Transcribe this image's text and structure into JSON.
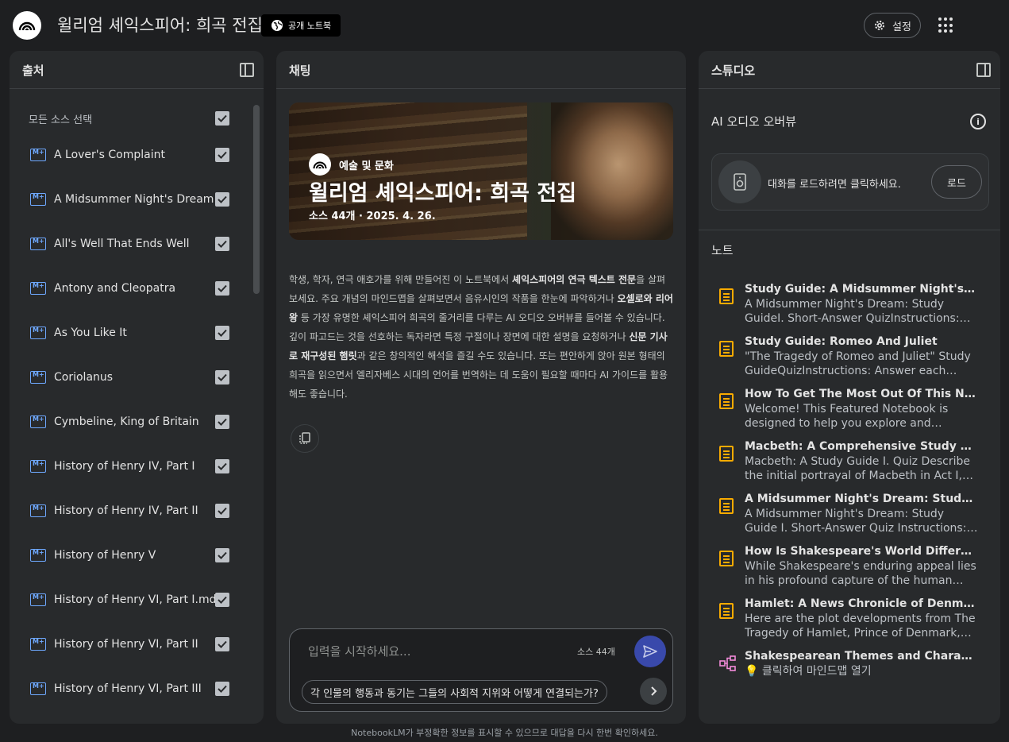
{
  "header": {
    "title": "윌리엄 셰익스피어: 희곡 전집",
    "public_badge": "공개 노트북",
    "settings_label": "설정"
  },
  "sources": {
    "panel_title": "출처",
    "select_all": "모든 소스 선택",
    "items": [
      {
        "label": "A Lover's Complaint"
      },
      {
        "label": "A Midsummer Night's Dream"
      },
      {
        "label": "All's Well That Ends Well"
      },
      {
        "label": "Antony and Cleopatra"
      },
      {
        "label": "As You Like It"
      },
      {
        "label": "Coriolanus"
      },
      {
        "label": "Cymbeline, King of Britain"
      },
      {
        "label": "History of Henry IV, Part I"
      },
      {
        "label": "History of Henry IV, Part II"
      },
      {
        "label": "History of Henry V"
      },
      {
        "label": "History of Henry VI, Part I.md"
      },
      {
        "label": "History of Henry VI, Part II"
      },
      {
        "label": "History of Henry VI, Part III"
      }
    ]
  },
  "chat": {
    "panel_title": "채팅",
    "hero": {
      "category": "예술 및 문화",
      "title": "윌리엄 셰익스피어: 희곡 전집",
      "subtitle": "소스 44개 · 2025. 4. 26."
    },
    "description": {
      "p1": "학생, 학자, 연극 애호가를 위해 만들어진 이 노트북에서 ",
      "b1": "셰익스피어의 연극 텍스트 전문",
      "p2": "을 살펴보세요. 주요 개념의 마인드맵을 살펴보면서 음유시인의 작품을 한눈에 파악하거나 ",
      "b2": "오셀로와 리어왕",
      "p3": " 등 가장 유명한 셰익스피어 희곡의 줄거리를 다루는 AI 오디오 오버뷰를 들어볼 수 있습니다. 깊이 파고드는 것을 선호하는 독자라면 특정 구절이나 장면에 대한 설명을 요청하거나 ",
      "b3": "신문 기사로 재구성된 햄릿",
      "p4": "과 같은 창의적인 해석을 즐길 수도 있습니다. 또는 편안하게 앉아 원본 형태의 희곡을 읽으면서 엘리자베스 시대의 언어를 번역하는 데 도움이 필요할 때마다 AI 가이드를 활용해도 좋습니다."
    },
    "input_placeholder": "입력을 시작하세요...",
    "source_count": "소스 44개",
    "suggestion": "각 인물의 행동과 동기는 그들의 사회적 지위와 어떻게 연결되는가?"
  },
  "studio": {
    "panel_title": "스튜디오",
    "audio_title": "AI 오디오 오버뷰",
    "audio_prompt": "대화를 로드하려면 클릭하세요.",
    "load_label": "로드",
    "notes_title": "노트",
    "notes": [
      {
        "title": "Study Guide: A Midsummer Night's Dream",
        "preview": "A Midsummer Night's Dream: Study GuideI. Short-Answer QuizInstructions: Answer each question in 2-3 sentences.",
        "icon": "note-icon"
      },
      {
        "title": "Study Guide: Romeo And Juliet",
        "preview": "\"The Tragedy of Romeo and Juliet\" Study GuideQuizInstructions: Answer each question in 2-3 sentences.",
        "icon": "note-icon"
      },
      {
        "title": "How To Get The Most Out Of This Notebook",
        "preview": "Welcome! This Featured Notebook is designed to help you explore and understand the complete works.",
        "icon": "note-icon"
      },
      {
        "title": "Macbeth: A Comprehensive Study Guide",
        "preview": "Macbeth: A Study Guide I. Quiz Describe the initial portrayal of Macbeth in Act I, Scenes 2-3.",
        "icon": "note-icon"
      },
      {
        "title": "A Midsummer Night's Dream: Study Guide",
        "preview": "A Midsummer Night's Dream: Study Guide I. Short-Answer Quiz Instructions: Answer each question.",
        "icon": "note-icon"
      },
      {
        "title": "How Is Shakespeare's World Different from Ours?",
        "preview": "While Shakespeare's enduring appeal lies in his profound capture of the human condition and timeless themes.",
        "icon": "note-icon"
      },
      {
        "title": "Hamlet: A News Chronicle of Denmark's Royal Tragedy",
        "preview": "Here are the plot developments from The Tragedy of Hamlet, Prince of Denmark, reported as news.",
        "icon": "note-icon"
      },
      {
        "title": "Shakespearean Themes and Characters Mind Map",
        "preview": "💡 클릭하여 마인드맵 열기",
        "icon": "mindmap-icon"
      }
    ]
  },
  "footer": {
    "disclaimer": "NotebookLM가 부정확한 정보를 표시할 수 있으므로 대답을 다시 한번 확인하세요."
  },
  "colors": {
    "background": "#1e1f21",
    "panel": "#282a2c",
    "accent_blue": "#6ea8fe",
    "note_orange": "#f9ab00",
    "mindmap_pink": "#f28bda",
    "send_button": "#3949ab"
  }
}
